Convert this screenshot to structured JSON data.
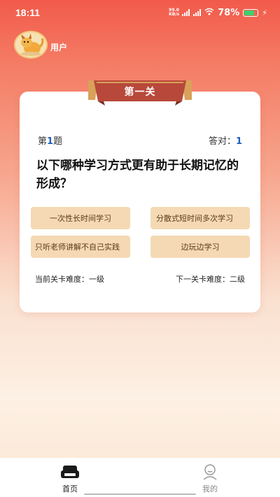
{
  "status": {
    "time": "18:11",
    "net_speed_top": "99.0",
    "net_speed_bottom": "KB/s",
    "battery": "78%"
  },
  "user": {
    "name": "用户"
  },
  "level": {
    "title": "第一关",
    "question_prefix": "第",
    "question_number": "1",
    "question_suffix": "题",
    "correct_label": "答对：",
    "correct_count": "1",
    "question_text": "以下哪种学习方式更有助于长期记忆的形成？",
    "options": [
      "一次性长时间学习",
      "分散式短时间多次学习",
      "只听老师讲解不自己实践",
      "边玩边学习"
    ],
    "current_difficulty": "当前关卡难度：一级",
    "next_difficulty": "下一关卡难度：二级"
  },
  "nav": {
    "home": "首页",
    "mine": "我的"
  },
  "colors": {
    "ribbon": "#b8483a",
    "option_bg": "#f5d9b4",
    "accent_blue": "#1e5fbf"
  }
}
